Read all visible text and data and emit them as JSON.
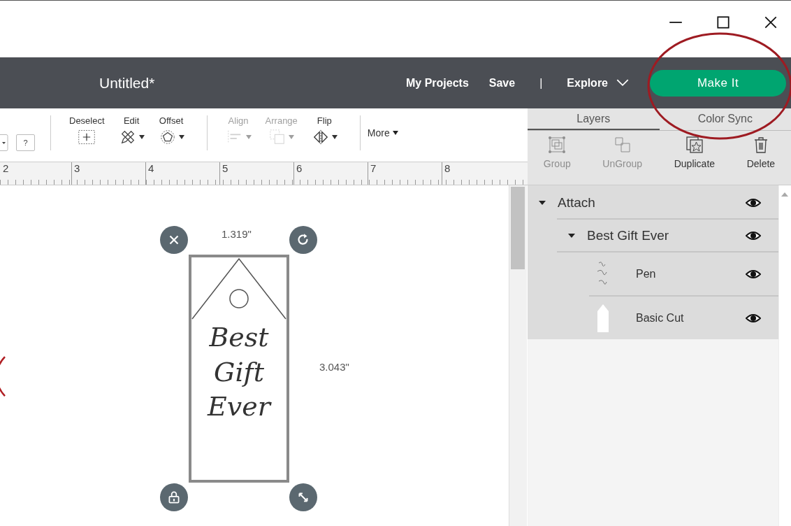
{
  "header": {
    "title": "Untitled*",
    "nav": [
      {
        "label": "My Projects",
        "kind": "link"
      },
      {
        "label": "Save",
        "kind": "link"
      },
      {
        "label": "|",
        "kind": "separator"
      },
      {
        "label": "Explore",
        "kind": "menu"
      }
    ],
    "make_button": "Make It"
  },
  "toolbar": {
    "help": "?",
    "tools": [
      {
        "label": "Deselect",
        "kind": "deselect",
        "disabled": false,
        "dropdown": false
      },
      {
        "label": "Edit",
        "kind": "edit",
        "disabled": false,
        "dropdown": true
      },
      {
        "label": "Offset",
        "kind": "offset",
        "disabled": false,
        "dropdown": true
      },
      {
        "label": "Align",
        "kind": "align",
        "disabled": true,
        "dropdown": true
      },
      {
        "label": "Arrange",
        "kind": "arrange",
        "disabled": true,
        "dropdown": true
      },
      {
        "label": "Flip",
        "kind": "flip",
        "disabled": false,
        "dropdown": true
      }
    ],
    "more": "More"
  },
  "ruler": {
    "labels": [
      "2",
      "3",
      "4",
      "5",
      "6",
      "7",
      "8"
    ]
  },
  "canvas": {
    "width_label": "1.319\"",
    "height_label": "3.043\"",
    "tag_lines": [
      "Best",
      "Gift",
      "Ever"
    ]
  },
  "panel": {
    "tabs": [
      {
        "label": "Layers",
        "selected": true
      },
      {
        "label": "Color Sync",
        "selected": false
      }
    ],
    "actions": [
      {
        "label": "Group",
        "kind": "group",
        "disabled": true
      },
      {
        "label": "UnGroup",
        "kind": "ungroup",
        "disabled": true
      },
      {
        "label": "Duplicate",
        "kind": "duplicate",
        "disabled": false
      },
      {
        "label": "Delete",
        "kind": "delete",
        "disabled": false
      }
    ],
    "layers": [
      {
        "name": "Attach",
        "expanded": true,
        "children": [
          {
            "name": "Best Gift Ever",
            "expanded": true,
            "children": [
              {
                "name": "Pen",
                "kind": "pen"
              },
              {
                "name": "Basic Cut",
                "kind": "cut"
              }
            ]
          }
        ]
      }
    ]
  }
}
